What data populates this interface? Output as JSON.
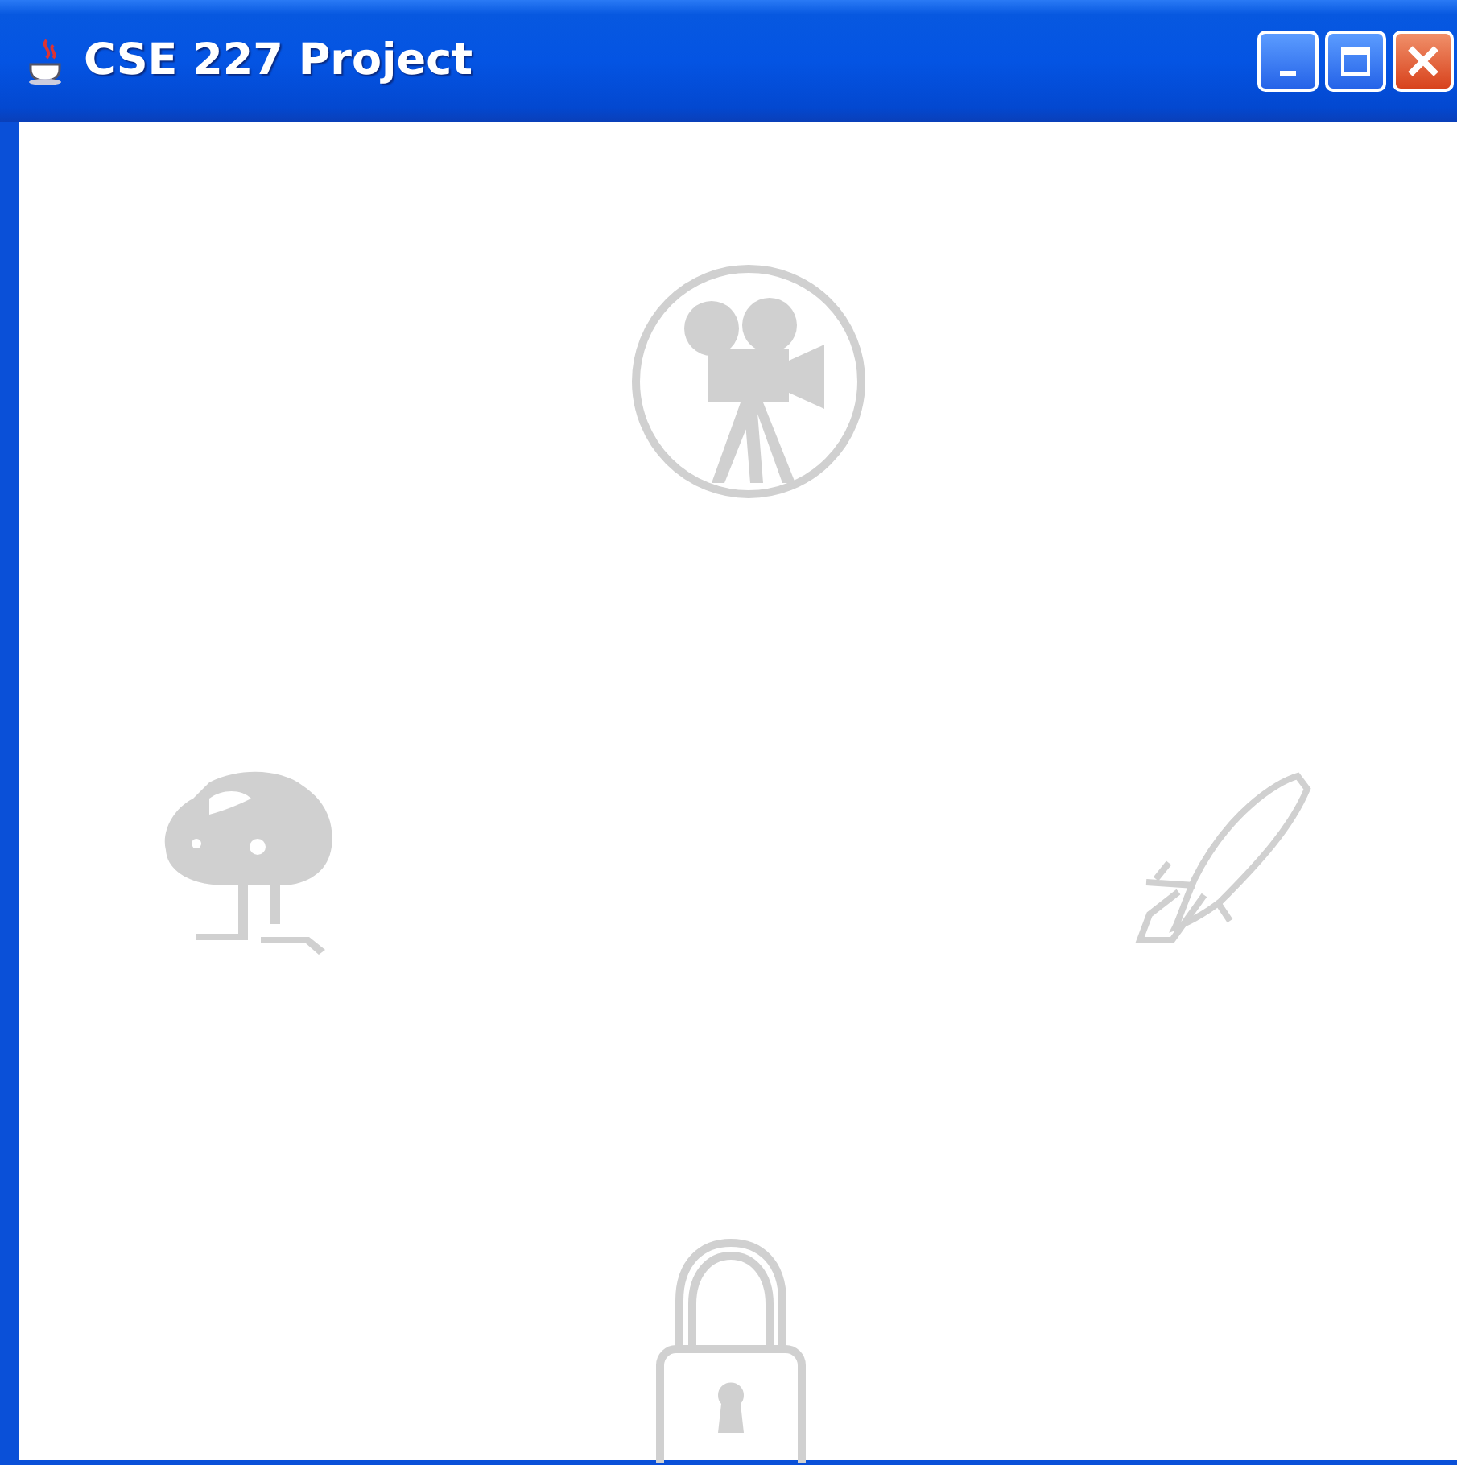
{
  "window": {
    "title": "CSE 227 Project"
  }
}
